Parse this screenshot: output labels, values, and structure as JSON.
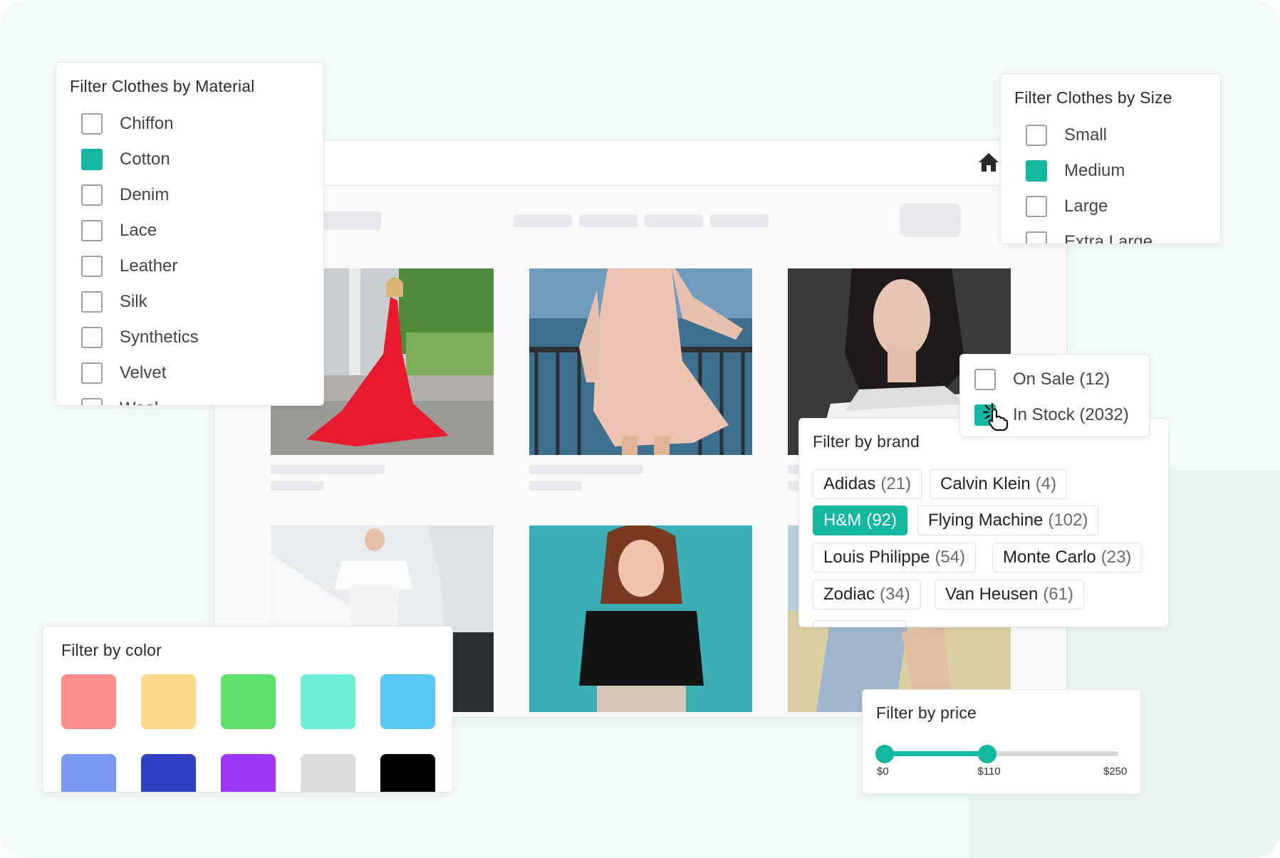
{
  "material": {
    "title": "Filter Clothes by Material",
    "items": [
      {
        "label": "Chiffon",
        "checked": false
      },
      {
        "label": "Cotton",
        "checked": true
      },
      {
        "label": "Denim",
        "checked": false
      },
      {
        "label": "Lace",
        "checked": false
      },
      {
        "label": "Leather",
        "checked": false
      },
      {
        "label": "Silk",
        "checked": false
      },
      {
        "label": "Synthetics",
        "checked": false
      },
      {
        "label": "Velvet",
        "checked": false
      },
      {
        "label": "Wool",
        "checked": false
      }
    ]
  },
  "size": {
    "title": "Filter Clothes by Size",
    "items": [
      {
        "label": "Small",
        "checked": false
      },
      {
        "label": "Medium",
        "checked": true
      },
      {
        "label": "Large",
        "checked": false
      },
      {
        "label": "Extra Large",
        "checked": false
      }
    ]
  },
  "availability": {
    "items": [
      {
        "label": "On Sale (12)",
        "checked": false
      },
      {
        "label": "In Stock (2032)",
        "checked": true
      }
    ]
  },
  "brand": {
    "title": "Filter by brand",
    "chips": [
      {
        "name": "Adidas",
        "count": "(21)",
        "active": false
      },
      {
        "name": "Calvin Klein",
        "count": "(4)",
        "active": false
      },
      {
        "name": "H&M",
        "count": "(92)",
        "active": true
      },
      {
        "name": "Flying Machine",
        "count": "(102)",
        "active": false
      },
      {
        "name": "Louis Philippe",
        "count": "(54)",
        "active": false
      },
      {
        "name": "Monte Carlo",
        "count": "(23)",
        "active": false
      },
      {
        "name": "Zodiac",
        "count": "(34)",
        "active": false
      },
      {
        "name": "Van Heusen",
        "count": "(61)",
        "active": false
      }
    ]
  },
  "color": {
    "title": "Filter by color",
    "swatches": [
      "#fe8e8b",
      "#fed88d",
      "#5ddf6c",
      "#6deed8",
      "#57c8f1",
      "#7a98f4",
      "#3040c2",
      "#9d36f5",
      "#dcdcdc",
      "#000000"
    ]
  },
  "price": {
    "title": "Filter by price",
    "min_label": "$0",
    "value_label": "$110",
    "max_label": "$250",
    "value": 110,
    "max": 250
  },
  "colors": {
    "accent": "#13b8a0",
    "window_red": "#f0463e",
    "window_yellow": "#f6c030",
    "window_green": "#2cc52a"
  },
  "icons": [
    "home-icon",
    "hand-pointer-icon"
  ]
}
